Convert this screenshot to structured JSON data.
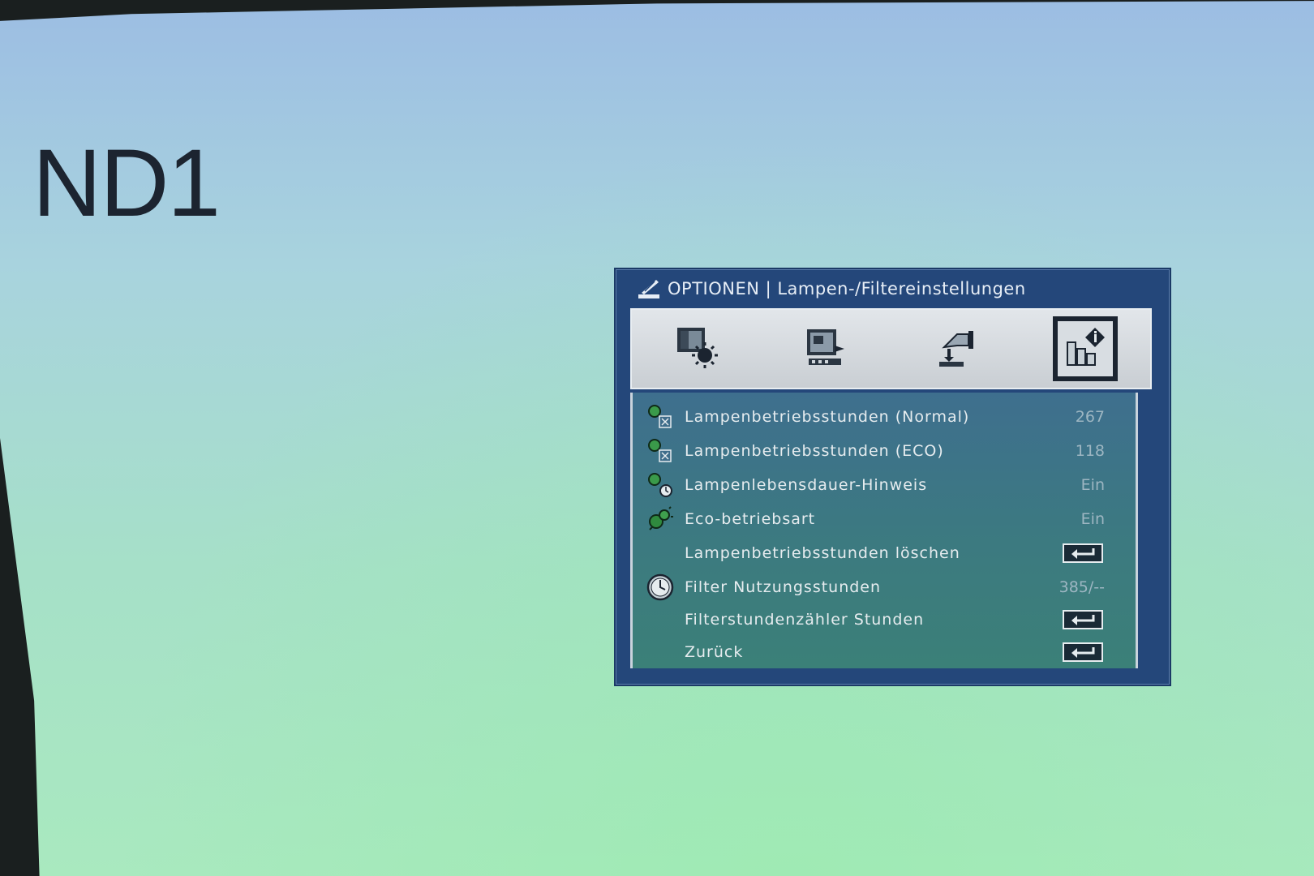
{
  "screen_label": "ND1",
  "osd": {
    "title": "OPTIONEN | Lampen-/Filtereinstellungen",
    "tabs": [
      {
        "icon": "image-settings-icon"
      },
      {
        "icon": "display-settings-icon"
      },
      {
        "icon": "setup-icon"
      },
      {
        "icon": "options-info-icon",
        "active": true
      }
    ],
    "items": [
      {
        "label": "Lampenbetriebsstunden (Normal)",
        "value": "267",
        "icon": "lamp-hours-icon"
      },
      {
        "label": "Lampenbetriebsstunden (ECO)",
        "value": "118",
        "icon": "lamp-hours-eco-icon"
      },
      {
        "label": "Lampenlebensdauer-Hinweis",
        "value": "Ein",
        "icon": "lamp-reminder-icon"
      },
      {
        "label": "Eco-betriebsart",
        "value": "Ein",
        "icon": "eco-mode-icon"
      },
      {
        "label": "Lampenbetriebsstunden löschen",
        "value": "",
        "icon": ""
      },
      {
        "label": "Filter Nutzungsstunden",
        "value": "385/--",
        "icon": "clock-icon"
      },
      {
        "label": "Filterstundenzähler Stunden",
        "value": "",
        "icon": ""
      },
      {
        "label": "Zurück",
        "value": "",
        "icon": ""
      }
    ]
  }
}
